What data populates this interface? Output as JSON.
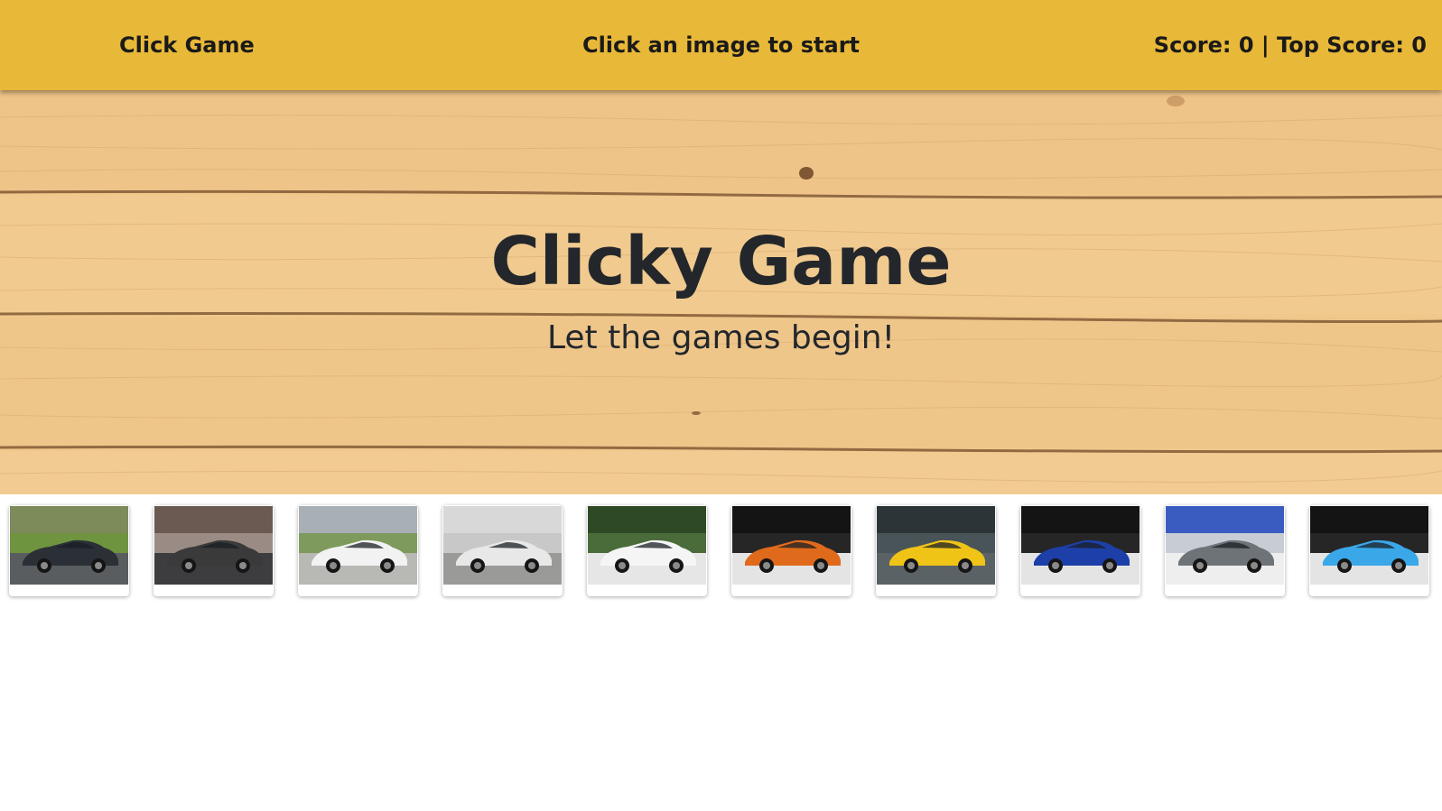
{
  "navbar": {
    "brand": "Click Game",
    "message": "Click an image to start",
    "score_text": "Score: 0 | Top Score: 0"
  },
  "jumbotron": {
    "title": "Clicky Game",
    "subtitle": "Let the games begin!"
  },
  "colors": {
    "navbar_bg": "#e8b838",
    "wood_base": "#f0c88c",
    "text_dark": "#23272b"
  },
  "cards": [
    {
      "icon": "car-photo-icon",
      "car_color": "#2b2f36",
      "scene": "track-grass"
    },
    {
      "icon": "car-photo-icon",
      "car_color": "#3a3a3a",
      "scene": "showroom-crowd"
    },
    {
      "icon": "car-photo-icon",
      "car_color": "#f2f2f2",
      "scene": "runway"
    },
    {
      "icon": "car-photo-icon",
      "car_color": "#e8e8e8",
      "scene": "studio-curtain"
    },
    {
      "icon": "car-photo-icon",
      "car_color": "#f5f5f5",
      "scene": "outdoor-trees"
    },
    {
      "icon": "car-photo-icon",
      "car_color": "#e06a1b",
      "scene": "dark-showroom"
    },
    {
      "icon": "car-photo-icon",
      "car_color": "#f0c417",
      "scene": "show-booth"
    },
    {
      "icon": "car-photo-icon",
      "car_color": "#1d3fa8",
      "scene": "dark-showroom"
    },
    {
      "icon": "car-photo-icon",
      "car_color": "#6e7378",
      "scene": "auto-show"
    },
    {
      "icon": "car-photo-icon",
      "car_color": "#3aa7e8",
      "scene": "dark-showroom"
    }
  ]
}
